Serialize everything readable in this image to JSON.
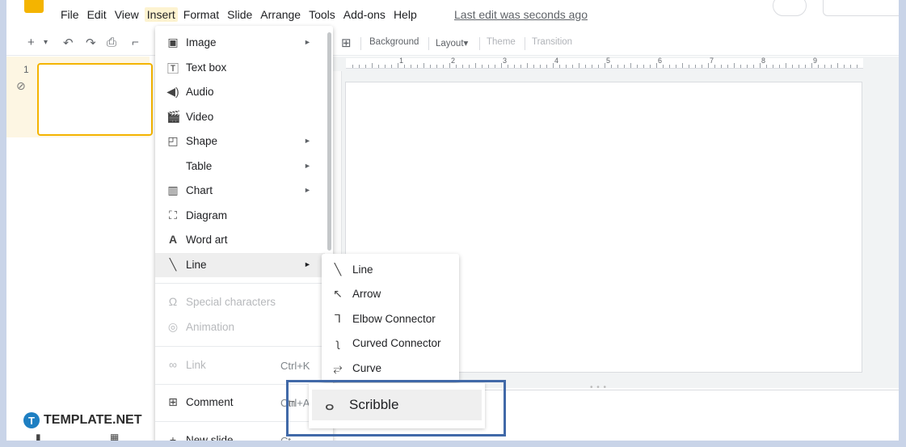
{
  "menubar": {
    "items": [
      "File",
      "Edit",
      "View",
      "Insert",
      "Format",
      "Slide",
      "Arrange",
      "Tools",
      "Add-ons",
      "Help"
    ],
    "active_item": "Insert",
    "last_edit": "Last edit was seconds ago"
  },
  "toolbar": {
    "background_label": "Background",
    "layout_label": "Layout▾",
    "theme_label": "Theme",
    "transition_label": "Transition"
  },
  "ruler": {
    "labels": [
      "1",
      "2",
      "3",
      "4",
      "5",
      "6",
      "7",
      "8",
      "9"
    ]
  },
  "filmstrip": {
    "slide_number": "1"
  },
  "insert_menu": {
    "items": [
      {
        "label": "Image",
        "icon": "image-icon",
        "has_submenu": true
      },
      {
        "label": "Text box",
        "icon": "text-box-icon",
        "has_submenu": false
      },
      {
        "label": "Audio",
        "icon": "audio-icon",
        "has_submenu": false
      },
      {
        "label": "Video",
        "icon": "video-icon",
        "has_submenu": false
      },
      {
        "label": "Shape",
        "icon": "shape-icon",
        "has_submenu": true
      },
      {
        "label": "Table",
        "icon": "",
        "has_submenu": true
      },
      {
        "label": "Chart",
        "icon": "chart-icon",
        "has_submenu": true
      },
      {
        "label": "Diagram",
        "icon": "diagram-icon",
        "has_submenu": false
      },
      {
        "label": "Word art",
        "icon": "word-art-icon",
        "has_submenu": false
      },
      {
        "label": "Line",
        "icon": "line-icon",
        "has_submenu": true,
        "hovered": true
      },
      {
        "label": "Special characters",
        "icon": "omega-icon",
        "disabled": true
      },
      {
        "label": "Animation",
        "icon": "animation-icon",
        "disabled": true
      },
      {
        "label": "Link",
        "icon": "link-icon",
        "disabled": true,
        "shortcut": "Ctrl+K"
      },
      {
        "label": "Comment",
        "icon": "comment-icon",
        "shortcut": "Ctrl+A"
      },
      {
        "label": "New slide",
        "icon": "new-slide-icon",
        "shortcut": "Ct"
      }
    ]
  },
  "line_submenu": {
    "items": [
      {
        "label": "Line",
        "icon": "line-icon"
      },
      {
        "label": "Arrow",
        "icon": "arrow-icon"
      },
      {
        "label": "Elbow Connector",
        "icon": "elbow-connector-icon"
      },
      {
        "label": "Curved Connector",
        "icon": "curved-connector-icon"
      },
      {
        "label": "Curve",
        "icon": "curve-icon"
      }
    ],
    "scribble": {
      "label": "Scribble",
      "icon": "scribble-icon"
    }
  },
  "watermark": {
    "logo_letter": "T",
    "text": "TEMPLATE.NET"
  },
  "colors": {
    "accent": "#f4b400",
    "highlight_border": "#4169a8",
    "watermark_blue": "#1e7fc2"
  }
}
